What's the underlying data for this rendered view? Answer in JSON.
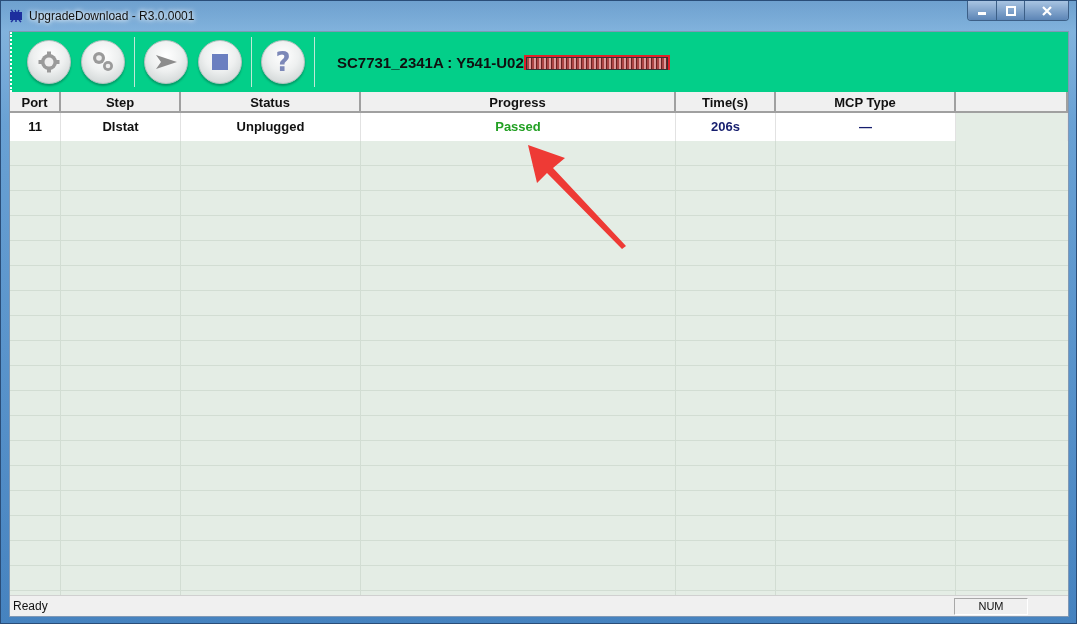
{
  "window": {
    "title": "UpgradeDownload - R3.0.0001"
  },
  "toolbar": {
    "buttons": [
      {
        "kind": "settings"
      },
      {
        "kind": "multi-settings"
      },
      {
        "kind": "start"
      },
      {
        "kind": "stop"
      },
      {
        "kind": "help",
        "label": "?"
      }
    ],
    "device_label": "SC7731_2341A : Y541-U02",
    "redacted": true
  },
  "table": {
    "columns": [
      "Port",
      "Step",
      "Status",
      "Progress",
      "Time(s)",
      "MCP Type"
    ],
    "rows": [
      {
        "cells": [
          "11",
          "DIstat",
          "Unplugged",
          "Passed",
          "206s",
          "—"
        ]
      }
    ]
  },
  "status_bar": {
    "message": "Ready",
    "indicator": "NUM"
  }
}
